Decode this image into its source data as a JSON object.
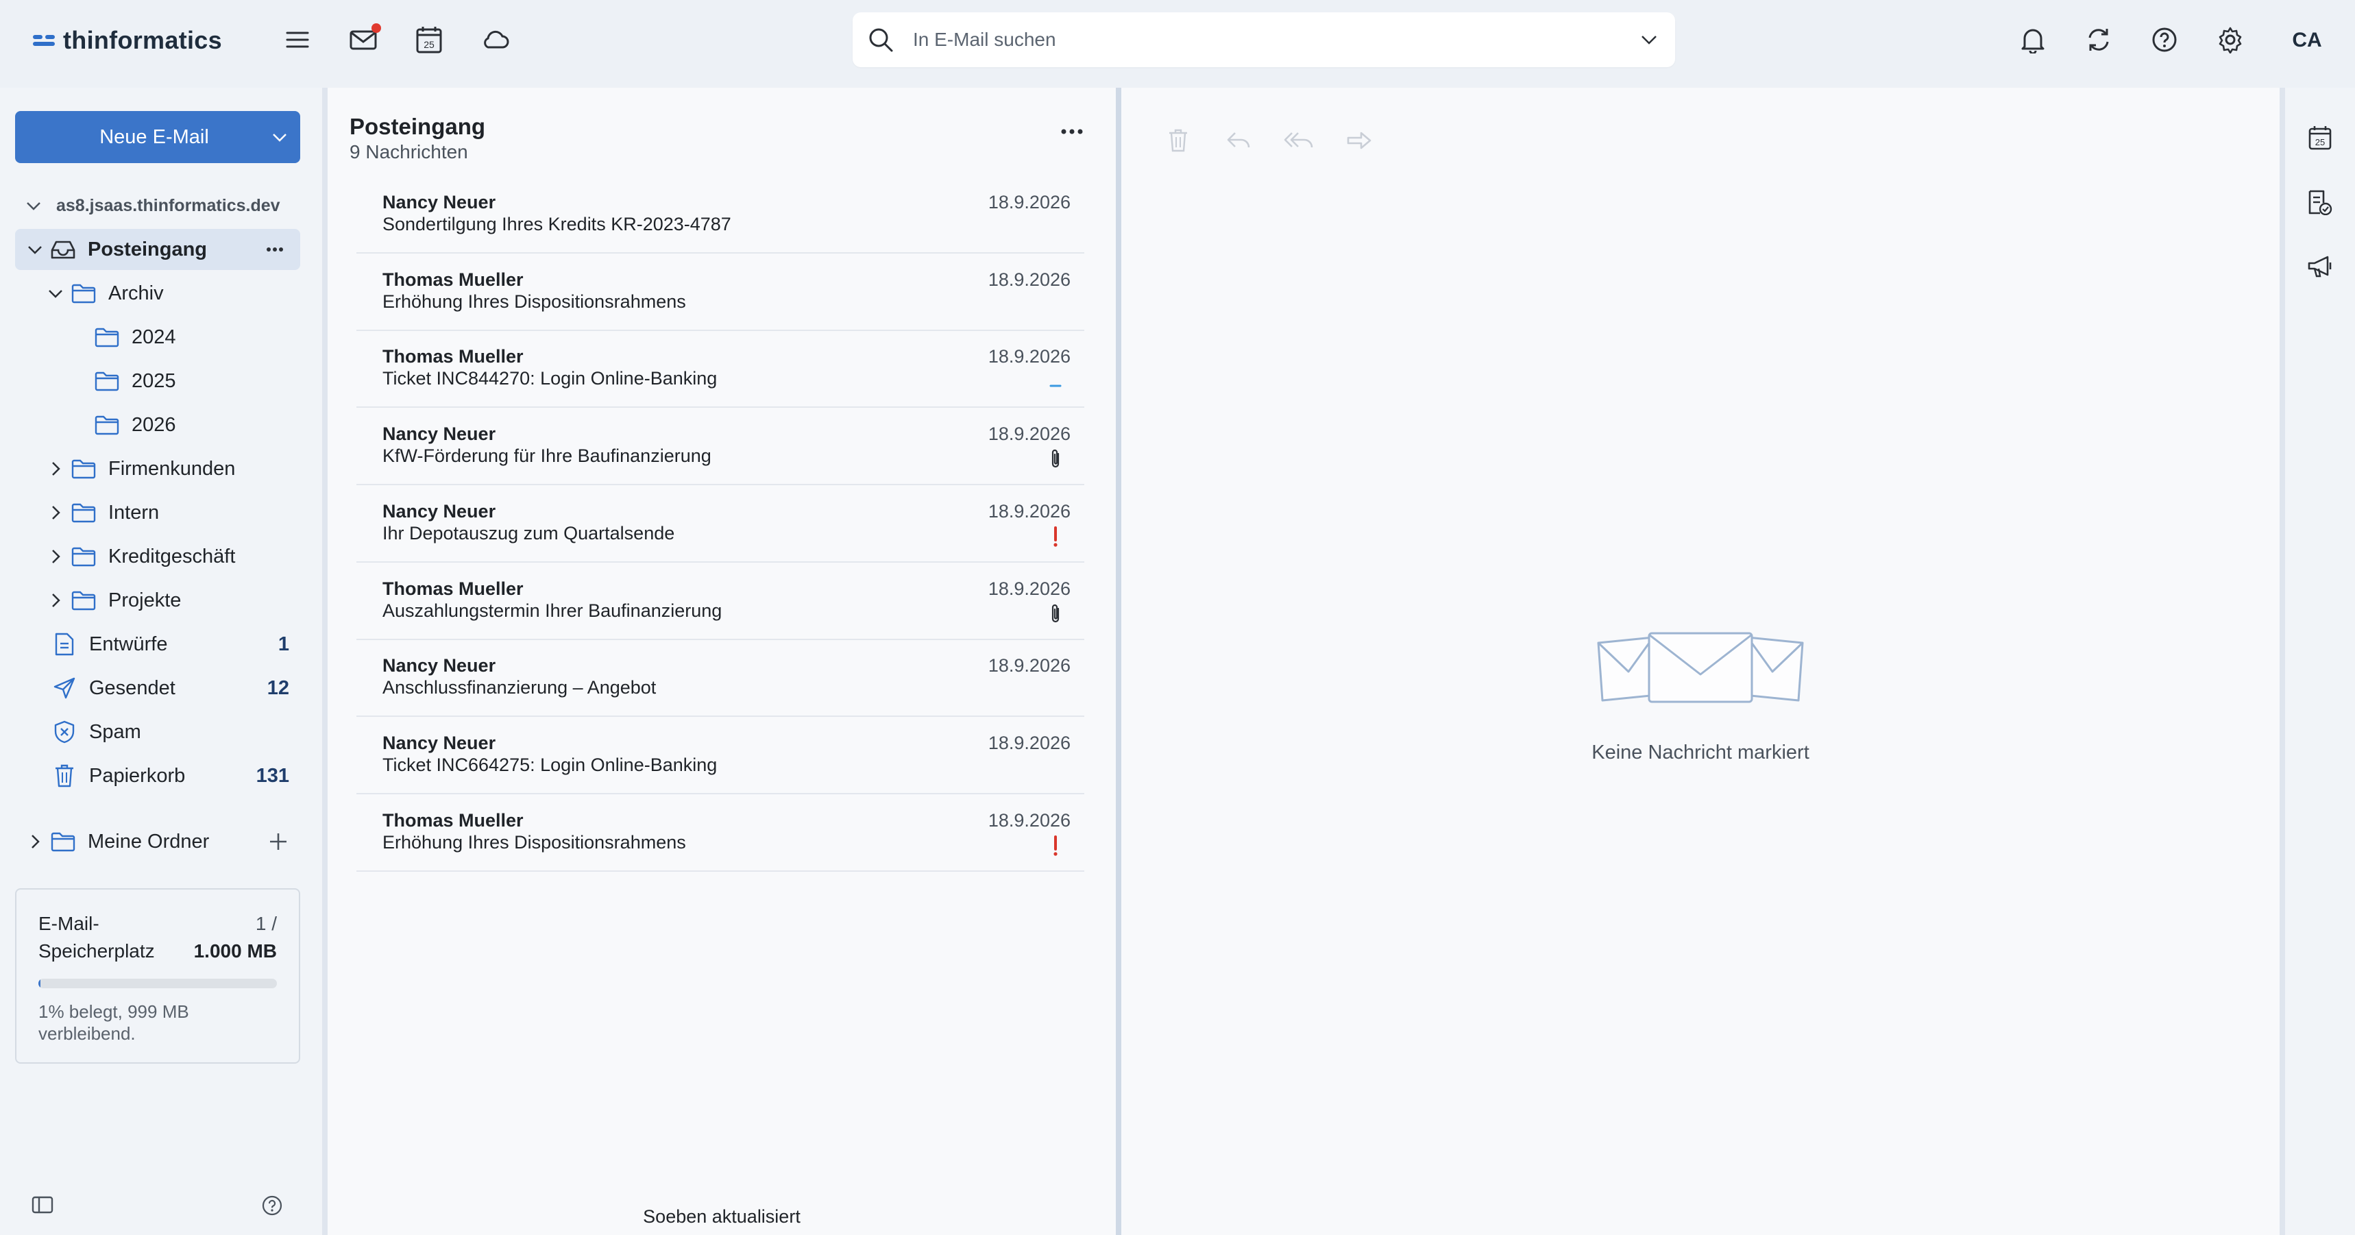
{
  "brand": {
    "name": "thinformatics"
  },
  "topbar": {
    "icons": [
      "menu-icon",
      "mail-icon",
      "calendar-icon",
      "cloud-icon"
    ],
    "calendar_day": "25",
    "search": {
      "placeholder": "In E-Mail suchen",
      "value": ""
    },
    "right_icons": [
      "bell-icon",
      "sync-icon",
      "help-icon",
      "gear-icon"
    ],
    "avatar_initials": "CA"
  },
  "sidebar": {
    "new_mail_label": "Neue E-Mail",
    "account": "as8.jsaas.thinformatics.dev",
    "folders": [
      {
        "label": "Posteingang",
        "count": ""
      },
      {
        "label": "Archiv",
        "count": ""
      },
      {
        "label": "2024",
        "count": ""
      },
      {
        "label": "2025",
        "count": ""
      },
      {
        "label": "2026",
        "count": ""
      },
      {
        "label": "Firmenkunden",
        "count": ""
      },
      {
        "label": "Intern",
        "count": ""
      },
      {
        "label": "Kreditgeschäft",
        "count": ""
      },
      {
        "label": "Projekte",
        "count": ""
      },
      {
        "label": "Entwürfe",
        "count": "1"
      },
      {
        "label": "Gesendet",
        "count": "12"
      },
      {
        "label": "Spam",
        "count": ""
      },
      {
        "label": "Papierkorb",
        "count": "131"
      }
    ],
    "my_folders_label": "Meine Ordner",
    "quota": {
      "title": "E-Mail-Speicherplatz",
      "used": "1 /",
      "total": "1.000 MB",
      "used_fraction": 0.01,
      "note": "1% belegt, 999 MB verbleibend."
    }
  },
  "list": {
    "title": "Posteingang",
    "subtitle": "9 Nachrichten",
    "status": "Soeben aktualisiert",
    "messages": [
      {
        "from": "Nancy Neuer",
        "subject": "Sondertilgung Ihres Kredits KR-2023-4787",
        "date": "18.9.2026",
        "flag": ""
      },
      {
        "from": "Thomas Mueller",
        "subject": "Erhöhung Ihres Dispositionsrahmens",
        "date": "18.9.2026",
        "flag": ""
      },
      {
        "from": "Thomas Mueller",
        "subject": "Ticket INC844270: Login Online-Banking",
        "date": "18.9.2026",
        "flag": "low-priority-icon"
      },
      {
        "from": "Nancy Neuer",
        "subject": "KfW-Förderung für Ihre Baufinanzierung",
        "date": "18.9.2026",
        "flag": "attachment-icon"
      },
      {
        "from": "Nancy Neuer",
        "subject": "Ihr Depotauszug zum Quartalsende",
        "date": "18.9.2026",
        "flag": "high-priority-icon"
      },
      {
        "from": "Thomas Mueller",
        "subject": "Auszahlungstermin Ihrer Baufinanzierung",
        "date": "18.9.2026",
        "flag": "attachment-icon"
      },
      {
        "from": "Nancy Neuer",
        "subject": "Anschlussfinanzierung – Angebot",
        "date": "18.9.2026",
        "flag": ""
      },
      {
        "from": "Nancy Neuer",
        "subject": "Ticket INC664275: Login Online-Banking",
        "date": "18.9.2026",
        "flag": ""
      },
      {
        "from": "Thomas Mueller",
        "subject": "Erhöhung Ihres Dispositionsrahmens",
        "date": "18.9.2026",
        "flag": "high-priority-icon"
      }
    ]
  },
  "reading": {
    "toolbar_icons": [
      "delete-icon",
      "reply-icon",
      "reply-all-icon",
      "forward-icon"
    ],
    "empty_text": "Keine Nachricht markiert"
  },
  "rail": {
    "icons": [
      "calendar-icon",
      "tasks-icon",
      "announcement-icon"
    ],
    "calendar_day": "25"
  },
  "colors": {
    "accent": "#3b75c9",
    "priority_high": "#d9362b",
    "priority_low": "#3b9ae1"
  }
}
